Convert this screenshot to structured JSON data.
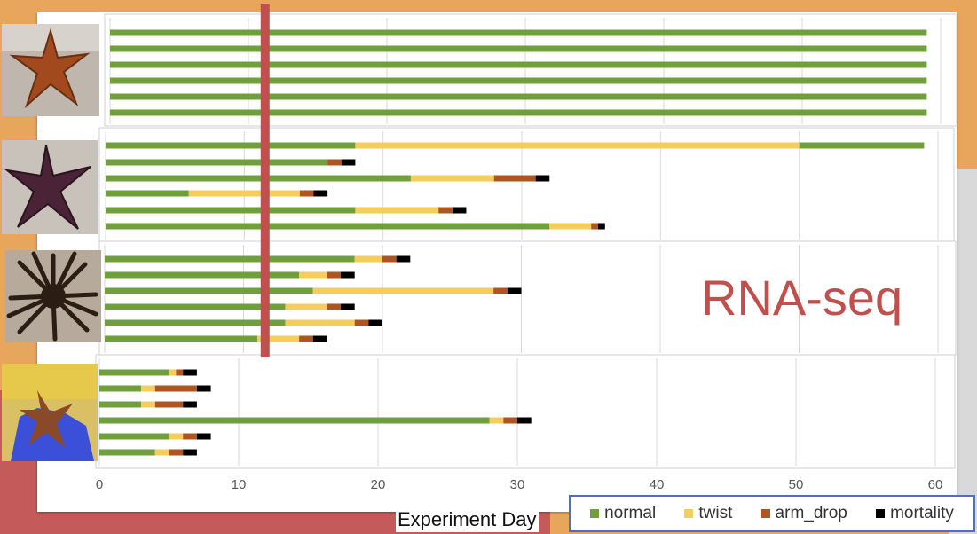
{
  "colors": {
    "normal": "#70a03c",
    "twist": "#f5cd5a",
    "arm_drop": "#b05520",
    "mortality": "#000000",
    "highlight": "#c0504d",
    "gridline": "#d9d9d9"
  },
  "annotation": {
    "text": "RNA-seq"
  },
  "chart_data": {
    "type": "bar",
    "orientation": "horizontal",
    "stacked": true,
    "xlabel": "Experiment Day",
    "xlim": [
      0,
      60
    ],
    "xticks": [
      0,
      10,
      20,
      30,
      40,
      50,
      60
    ],
    "grid": true,
    "legend_position": "bottom-right",
    "series_names": [
      "normal",
      "twist",
      "arm_drop",
      "mortality"
    ],
    "reference_line": {
      "x": 11.5
    },
    "panels": [
      {
        "photo_icon": "sea-star-orange-photo-icon",
        "bars": [
          {
            "normal": 59,
            "twist": 0,
            "arm_drop": 0,
            "mortality": 0
          },
          {
            "normal": 59,
            "twist": 0,
            "arm_drop": 0,
            "mortality": 0
          },
          {
            "normal": 59,
            "twist": 0,
            "arm_drop": 0,
            "mortality": 0
          },
          {
            "normal": 59,
            "twist": 0,
            "arm_drop": 0,
            "mortality": 0
          },
          {
            "normal": 59,
            "twist": 0,
            "arm_drop": 0,
            "mortality": 0
          },
          {
            "normal": 59,
            "twist": 0,
            "arm_drop": 0,
            "mortality": 0
          }
        ]
      },
      {
        "photo_icon": "sea-star-purple-photo-icon",
        "bars": [
          {
            "normal": 18,
            "twist": 32,
            "arm_drop": 0,
            "mortality": 0,
            "normal_after": 9
          },
          {
            "normal": 16,
            "twist": 0,
            "arm_drop": 1,
            "mortality": 1
          },
          {
            "normal": 22,
            "twist": 6,
            "arm_drop": 3,
            "mortality": 1
          },
          {
            "normal": 6,
            "twist": 8,
            "arm_drop": 1,
            "mortality": 1
          },
          {
            "normal": 18,
            "twist": 6,
            "arm_drop": 1,
            "mortality": 1
          },
          {
            "normal": 32,
            "twist": 3,
            "arm_drop": 0.5,
            "mortality": 0.5
          }
        ]
      },
      {
        "photo_icon": "sunflower-star-photo-icon",
        "bars": [
          {
            "normal": 18,
            "twist": 2,
            "arm_drop": 1,
            "mortality": 1
          },
          {
            "normal": 14,
            "twist": 2,
            "arm_drop": 1,
            "mortality": 1
          },
          {
            "normal": 15,
            "twist": 13,
            "arm_drop": 1,
            "mortality": 1
          },
          {
            "normal": 13,
            "twist": 3,
            "arm_drop": 1,
            "mortality": 1
          },
          {
            "normal": 13,
            "twist": 5,
            "arm_drop": 1,
            "mortality": 1
          },
          {
            "normal": 11,
            "twist": 3,
            "arm_drop": 1,
            "mortality": 1
          }
        ]
      },
      {
        "photo_icon": "sea-star-in-hand-photo-icon",
        "bars": [
          {
            "normal": 5,
            "twist": 0.5,
            "arm_drop": 0.5,
            "mortality": 1
          },
          {
            "normal": 3,
            "twist": 1,
            "arm_drop": 3,
            "mortality": 1
          },
          {
            "normal": 3,
            "twist": 1,
            "arm_drop": 2,
            "mortality": 1
          },
          {
            "normal": 28,
            "twist": 1,
            "arm_drop": 1,
            "mortality": 1
          },
          {
            "normal": 5,
            "twist": 1,
            "arm_drop": 1,
            "mortality": 1
          },
          {
            "normal": 4,
            "twist": 1,
            "arm_drop": 1,
            "mortality": 1
          }
        ]
      }
    ]
  }
}
